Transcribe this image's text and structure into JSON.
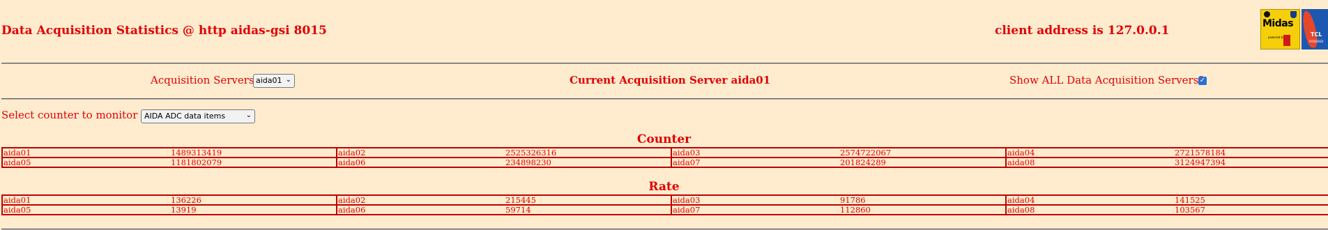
{
  "header": {
    "title": "Data Acquisition Statistics @ http aidas-gsi 8015",
    "client_address": "client address is 127.0.0.1",
    "midas_logo_text": "Midas",
    "midas_logo_small": "powered by",
    "tcl_logo_text": "TCL",
    "tcl_logo_small": "POWERED"
  },
  "servers": {
    "label": "Acquisition Servers",
    "selected": "aida01",
    "current": "Current Acquisition Server aida01",
    "show_all_label": "Show ALL Data Acquisition Servers?",
    "show_all_checked": true
  },
  "counter_select": {
    "label": "Select counter to monitor",
    "selected": "AIDA ADC data items"
  },
  "counter": {
    "title": "Counter",
    "rows": [
      [
        {
          "name": "aida01",
          "value": "1489313419"
        },
        {
          "name": "aida02",
          "value": "2525326316"
        },
        {
          "name": "aida03",
          "value": "2574722067"
        },
        {
          "name": "aida04",
          "value": "2721578184"
        }
      ],
      [
        {
          "name": "aida05",
          "value": "1181802079"
        },
        {
          "name": "aida06",
          "value": "234898230"
        },
        {
          "name": "aida07",
          "value": "201824289"
        },
        {
          "name": "aida08",
          "value": "3124947394"
        }
      ]
    ]
  },
  "rate": {
    "title": "Rate",
    "rows": [
      [
        {
          "name": "aida01",
          "value": "136226"
        },
        {
          "name": "aida02",
          "value": "215445"
        },
        {
          "name": "aida03",
          "value": "91786"
        },
        {
          "name": "aida04",
          "value": "141525"
        }
      ],
      [
        {
          "name": "aida05",
          "value": "13919"
        },
        {
          "name": "aida06",
          "value": "59714"
        },
        {
          "name": "aida07",
          "value": "112860"
        },
        {
          "name": "aida08",
          "value": "103567"
        }
      ]
    ]
  }
}
